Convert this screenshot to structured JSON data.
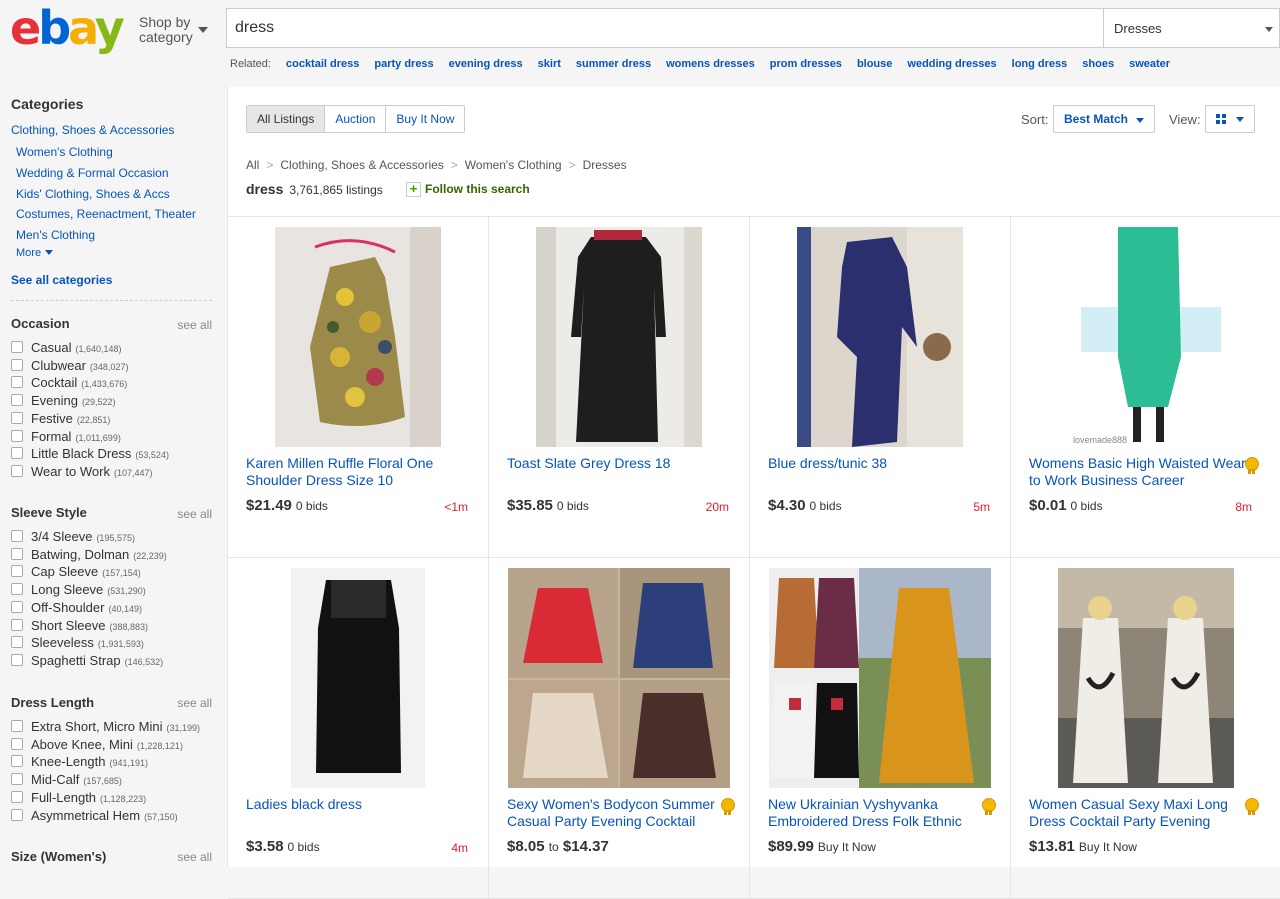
{
  "header": {
    "logo": {
      "e": "e",
      "b": "b",
      "a": "a",
      "y": "y"
    },
    "shop_by": "Shop by category",
    "search_value": "dress",
    "category_select": "Dresses",
    "related_label": "Related:",
    "related": [
      "cocktail dress",
      "party dress",
      "evening dress",
      "skirt",
      "summer dress",
      "womens dresses",
      "prom dresses",
      "blouse",
      "wedding dresses",
      "long dress",
      "shoes",
      "sweater"
    ]
  },
  "sidebar": {
    "categories_title": "Categories",
    "cat_links": [
      "Clothing, Shoes & Accessories",
      "Women's Clothing",
      "Wedding & Formal Occasion",
      "Kids' Clothing, Shoes & Accs",
      "Costumes, Reenactment, Theater",
      "Men's Clothing",
      "More"
    ],
    "see_all_categories": "See all categories",
    "see_all": "see all",
    "occasion": {
      "title": "Occasion",
      "items": [
        {
          "label": "Casual",
          "count": "(1,640,148)"
        },
        {
          "label": "Clubwear",
          "count": "(348,027)"
        },
        {
          "label": "Cocktail",
          "count": "(1,433,676)"
        },
        {
          "label": "Evening",
          "count": "(29,522)"
        },
        {
          "label": "Festive",
          "count": "(22,851)"
        },
        {
          "label": "Formal",
          "count": "(1,011,699)"
        },
        {
          "label": "Little Black Dress",
          "count": "(53,524)"
        },
        {
          "label": "Wear to Work",
          "count": "(107,447)"
        }
      ]
    },
    "sleeve": {
      "title": "Sleeve Style",
      "items": [
        {
          "label": "3/4 Sleeve",
          "count": "(195,575)"
        },
        {
          "label": "Batwing, Dolman",
          "count": "(22,239)"
        },
        {
          "label": "Cap Sleeve",
          "count": "(157,154)"
        },
        {
          "label": "Long Sleeve",
          "count": "(531,290)"
        },
        {
          "label": "Off-Shoulder",
          "count": "(40,149)"
        },
        {
          "label": "Short Sleeve",
          "count": "(388,883)"
        },
        {
          "label": "Sleeveless",
          "count": "(1,931,593)"
        },
        {
          "label": "Spaghetti Strap",
          "count": "(146,532)"
        }
      ]
    },
    "length": {
      "title": "Dress Length",
      "items": [
        {
          "label": "Extra Short, Micro Mini",
          "count": "(31,199)"
        },
        {
          "label": "Above Knee, Mini",
          "count": "(1,228,121)"
        },
        {
          "label": "Knee-Length",
          "count": "(941,191)"
        },
        {
          "label": "Mid-Calf",
          "count": "(157,685)"
        },
        {
          "label": "Full-Length",
          "count": "(1,128,223)"
        },
        {
          "label": "Asymmetrical Hem",
          "count": "(57,150)"
        }
      ]
    },
    "size_title": "Size (Women's)"
  },
  "toolbar": {
    "tabs": [
      "All Listings",
      "Auction",
      "Buy It Now"
    ],
    "sort_label": "Sort:",
    "sort_value": "Best Match",
    "view_label": "View:"
  },
  "breadcrumb": [
    "All",
    "Clothing, Shoes & Accessories",
    "Women's Clothing",
    "Dresses"
  ],
  "results": {
    "keyword": "dress",
    "count": "3,761,865 listings",
    "follow": "Follow this search"
  },
  "listings": [
    {
      "title": "Karen Millen Ruffle Floral One Shoulder Dress Size 10",
      "price": "$21.49",
      "bids": "0 bids",
      "time": "<1m"
    },
    {
      "title": "Toast Slate Grey Dress 18",
      "price": "$35.85",
      "bids": "0 bids",
      "time": "20m"
    },
    {
      "title": "Blue dress/tunic 38",
      "price": "$4.30",
      "bids": "0 bids",
      "time": "5m"
    },
    {
      "title": "Womens Basic High Waisted Wear to Work Business Career",
      "price": "$0.01",
      "bids": "0 bids",
      "time": "8m",
      "watermark": "lovemade888"
    },
    {
      "title": "Ladies black dress",
      "price": "$3.58",
      "bids": "0 bids",
      "time": "4m"
    },
    {
      "title": "Sexy Women's Bodycon Summer Casual Party Evening Cocktail",
      "price": "$8.05",
      "to": "to",
      "price2": "$14.37"
    },
    {
      "title": "New Ukrainian Vyshyvanka Embroidered Dress Folk Ethnic",
      "price": "$89.99",
      "bids": "Buy It Now"
    },
    {
      "title": "Women Casual Sexy Maxi Long Dress Cocktail Party Evening",
      "price": "$13.81",
      "bids": "Buy It Now"
    }
  ]
}
